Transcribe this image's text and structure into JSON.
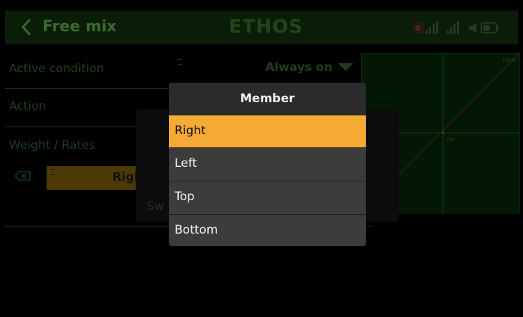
{
  "header": {
    "title": "Free mix",
    "brand": "ETHOS"
  },
  "rows": [
    {
      "label": "Active condition",
      "value": "Always on"
    },
    {
      "label": "Action"
    },
    {
      "label": "Weight / Rates",
      "source_value": "Right"
    }
  ],
  "graph": {
    "max_label": "100%",
    "mid_label": "0%"
  },
  "back_dialog": {
    "label": "Sw"
  },
  "popup": {
    "title": "Member",
    "options": [
      "Right",
      "Left",
      "Top",
      "Bottom"
    ],
    "selected": "Right"
  },
  "colors": {
    "accent": "#f4aa34",
    "popup_bg": "#3c3c3c",
    "dim_green": "#1f3d1a"
  }
}
